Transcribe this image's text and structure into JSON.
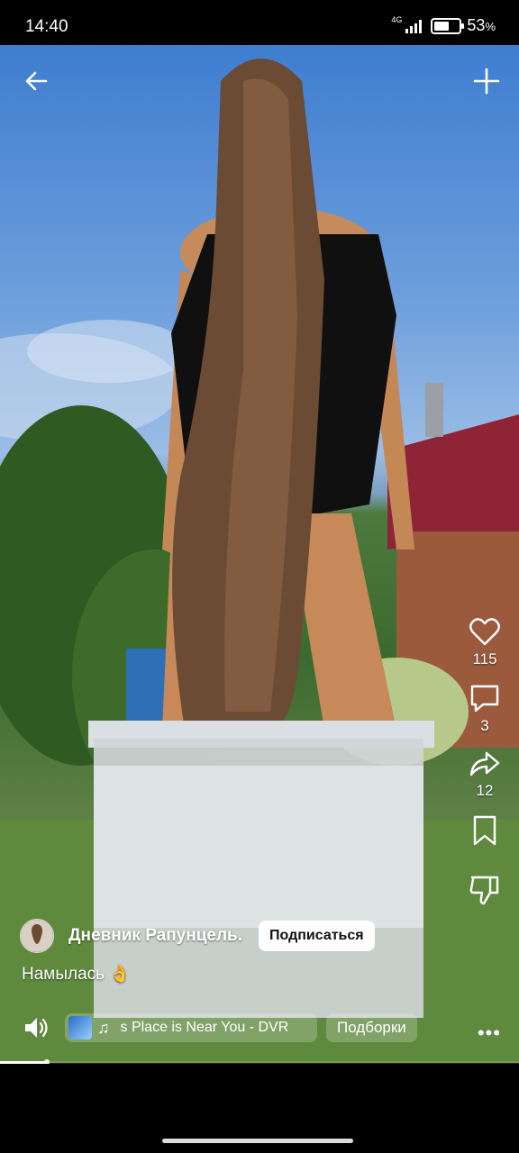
{
  "status_bar": {
    "time": "14:40",
    "network": "4G",
    "battery_percent": "53",
    "battery_symbol": "%",
    "battery_level": 0.53
  },
  "top_bar": {
    "back_icon": "arrow-left-icon",
    "add_icon": "plus-icon"
  },
  "actions": {
    "likes": "115",
    "comments": "3",
    "shares": "12",
    "icons": [
      "heart-icon",
      "comment-icon",
      "share-icon",
      "bookmark-icon",
      "dislike-icon"
    ]
  },
  "author": {
    "name": "Дневник Рапунцель.",
    "subscribe_label": "Подписаться"
  },
  "caption": "Намылась 👌",
  "music": {
    "text": "s Place is Near You - DVR",
    "icon": "music-note-icon"
  },
  "collections_label": "Подборки",
  "video_progress": 0.09,
  "colors": {
    "background": "#000000",
    "button_bg": "#ffffff",
    "chip_bg": "rgba(255,255,255,0.22)"
  }
}
